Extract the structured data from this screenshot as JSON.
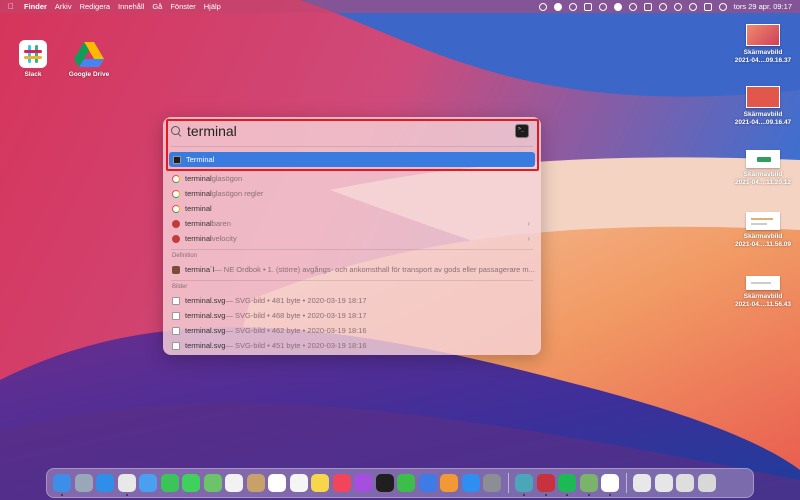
{
  "menubar": {
    "apple_icon": "apple-icon",
    "items": [
      "Finder",
      "Arkiv",
      "Redigera",
      "Innehåll",
      "Gå",
      "Fönster",
      "Hjälp"
    ],
    "clock": "tors 29 apr.  09:17"
  },
  "desktop": {
    "left_icons": [
      {
        "label": "Slack",
        "color": "#ffffff"
      },
      {
        "label": "Google Drive",
        "color": "#ffffff"
      }
    ],
    "screenshots": [
      {
        "line1": "Skärmavbild",
        "line2": "2021-04....09.16.37",
        "color": "#e2574c"
      },
      {
        "line1": "Skärmavbild",
        "line2": "2021-04....09.16.47",
        "color": "#e2574c"
      },
      {
        "line1": "Skärmavbild",
        "line2": "2021-04....11.20.12",
        "color": "#ffffff"
      },
      {
        "line1": "Skärmavbild",
        "line2": "2021-04....11.56.09",
        "color": "#ffffff"
      },
      {
        "line1": "Skärmavbild",
        "line2": "2021-04....11.56.43",
        "color": "#ffffff"
      }
    ]
  },
  "spotlight": {
    "query": "terminal",
    "top_hit": "Terminal",
    "suggestions": [
      {
        "bold": "terminal",
        "rest": "glasögon",
        "icon": "google-icon",
        "chevron": false
      },
      {
        "bold": "terminal",
        "rest": "glasögon regler",
        "icon": "google-icon",
        "chevron": false
      },
      {
        "bold": "terminal",
        "rest": "",
        "icon": "google-icon",
        "chevron": false
      },
      {
        "bold": "terminal",
        "rest": "baren",
        "icon": "safari-icon",
        "chevron": true
      },
      {
        "bold": "terminal",
        "rest": " velocity",
        "icon": "safari-icon",
        "chevron": true
      }
    ],
    "definition_header": "Definition",
    "definition": {
      "bold": "termina´l",
      "rest": " — NE Ordbok • 1. (större) avgångs- och ankomsthall för transport av gods eller passagerare m..."
    },
    "images_header": "Bilder",
    "images": [
      {
        "name": "terminal.svg",
        "meta": " — SVG-bild • 481 byte • 2020-03-19 18:17"
      },
      {
        "name": "terminal.svg",
        "meta": " — SVG-bild • 468 byte • 2020-03-19 18:17"
      },
      {
        "name": "terminal.svg",
        "meta": " — SVG-bild • 462 byte • 2020-03-19 18:16"
      },
      {
        "name": "terminal.svg",
        "meta": " — SVG-bild • 451 byte • 2020-03-19 18:16"
      }
    ]
  },
  "dock": {
    "apps": [
      {
        "name": "finder-icon",
        "color": "#3d8ee8",
        "running": true
      },
      {
        "name": "launchpad-icon",
        "color": "#9aa7b8",
        "running": false
      },
      {
        "name": "safari-icon",
        "color": "#2f8fe8",
        "running": false
      },
      {
        "name": "chrome-icon",
        "color": "#e8e8e8",
        "running": true
      },
      {
        "name": "mail-icon",
        "color": "#4a9ff0",
        "running": false
      },
      {
        "name": "facetime-icon",
        "color": "#3bc45a",
        "running": false
      },
      {
        "name": "messages-icon",
        "color": "#3fd05d",
        "running": false
      },
      {
        "name": "maps-icon",
        "color": "#6cc36a",
        "running": false
      },
      {
        "name": "photos-icon",
        "color": "#f2f2f2",
        "running": false
      },
      {
        "name": "contacts-icon",
        "color": "#c8a06a",
        "running": false
      },
      {
        "name": "calendar-icon",
        "color": "#ffffff",
        "running": false
      },
      {
        "name": "reminders-icon",
        "color": "#f5f5f5",
        "running": false
      },
      {
        "name": "notes-icon",
        "color": "#f7d64b",
        "running": false
      },
      {
        "name": "music-icon",
        "color": "#f2455b",
        "running": false
      },
      {
        "name": "podcasts-icon",
        "color": "#a64ee0",
        "running": false
      },
      {
        "name": "tv-icon",
        "color": "#1f1f1f",
        "running": false
      },
      {
        "name": "numbers-icon",
        "color": "#3dbd4a",
        "running": false
      },
      {
        "name": "keynote-icon",
        "color": "#3f7be6",
        "running": false
      },
      {
        "name": "pages-icon",
        "color": "#f19a35",
        "running": false
      },
      {
        "name": "app-store-icon",
        "color": "#2e8ff0",
        "running": false
      },
      {
        "name": "system-preferences-icon",
        "color": "#8b8f95",
        "running": false
      },
      {
        "name": "sep",
        "color": "",
        "running": false
      },
      {
        "name": "big-sur-installer-icon",
        "color": "#4aa6b8",
        "running": true
      },
      {
        "name": "scrobbler-icon",
        "color": "#c8323c",
        "running": true
      },
      {
        "name": "spotify-icon",
        "color": "#1db954",
        "running": true
      },
      {
        "name": "maps-dock-icon",
        "color": "#7cb36a",
        "running": true
      },
      {
        "name": "slack-dock-icon",
        "color": "#ffffff",
        "running": true
      },
      {
        "name": "sep",
        "color": "",
        "running": false
      },
      {
        "name": "preview-icon",
        "color": "#e8e8e8",
        "running": false
      },
      {
        "name": "documents-folder-icon",
        "color": "#e6e6e6",
        "running": false
      },
      {
        "name": "downloads-folder-icon",
        "color": "#dedede",
        "running": false
      },
      {
        "name": "trash-icon",
        "color": "#d8d8d8",
        "running": false
      }
    ]
  }
}
